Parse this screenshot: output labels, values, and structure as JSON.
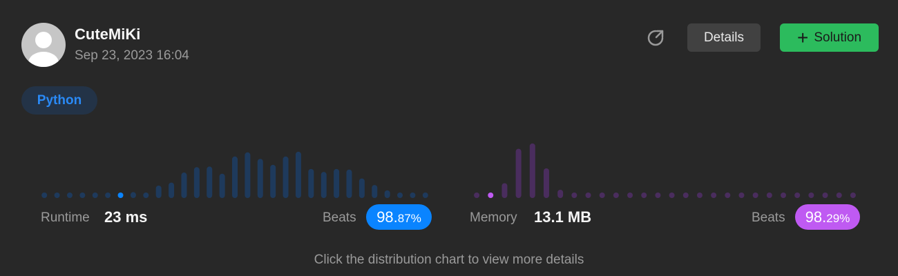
{
  "submission": {
    "username": "CuteMiKi",
    "date": "Sep 23, 2023 16:04",
    "language": "Python"
  },
  "actions": {
    "details_label": "Details",
    "solution_label": "Solution"
  },
  "runtime": {
    "label": "Runtime",
    "value": "23 ms",
    "beats_label": "Beats",
    "beats_int": "98.",
    "beats_dec": "87%",
    "color": "#0a84ff",
    "bar_color": "#1e3a5c",
    "highlight_index": 6
  },
  "memory": {
    "label": "Memory",
    "value": "13.1 MB",
    "beats_label": "Beats",
    "beats_int": "98.",
    "beats_dec": "29%",
    "color": "#bf5af2",
    "bar_color": "#4a2d5e",
    "highlight_index": 1
  },
  "footer_hint": "Click the distribution chart to view more details",
  "chart_data": [
    {
      "type": "bar",
      "name": "runtime-distribution",
      "values": [
        0.4,
        0.4,
        0.4,
        0.4,
        0.4,
        0.4,
        0.4,
        1.0,
        0.6,
        2.1,
        2.6,
        4.3,
        5.2,
        5.3,
        4.1,
        7.0,
        7.7,
        6.6,
        5.6,
        7.0,
        7.8,
        4.9,
        4.4,
        4.9,
        4.8,
        3.3,
        2.2,
        1.3,
        0.9,
        0.6,
        0.4
      ],
      "highlight_index": 6,
      "highlight_color": "#0a84ff"
    },
    {
      "type": "bar",
      "name": "memory-distribution",
      "values": [
        0.4,
        0.4,
        2.5,
        8.3,
        9.2,
        5.0,
        1.4,
        0.4,
        0.4,
        0.4,
        0.4,
        0.4,
        0.4,
        0.4,
        0.4,
        0.4,
        0.4,
        0.4,
        0.4,
        0.4,
        0.4,
        0.4,
        0.4,
        0.4,
        0.4,
        0.4,
        0.4,
        0.4
      ],
      "highlight_index": 1,
      "highlight_color": "#bf5af2"
    }
  ]
}
